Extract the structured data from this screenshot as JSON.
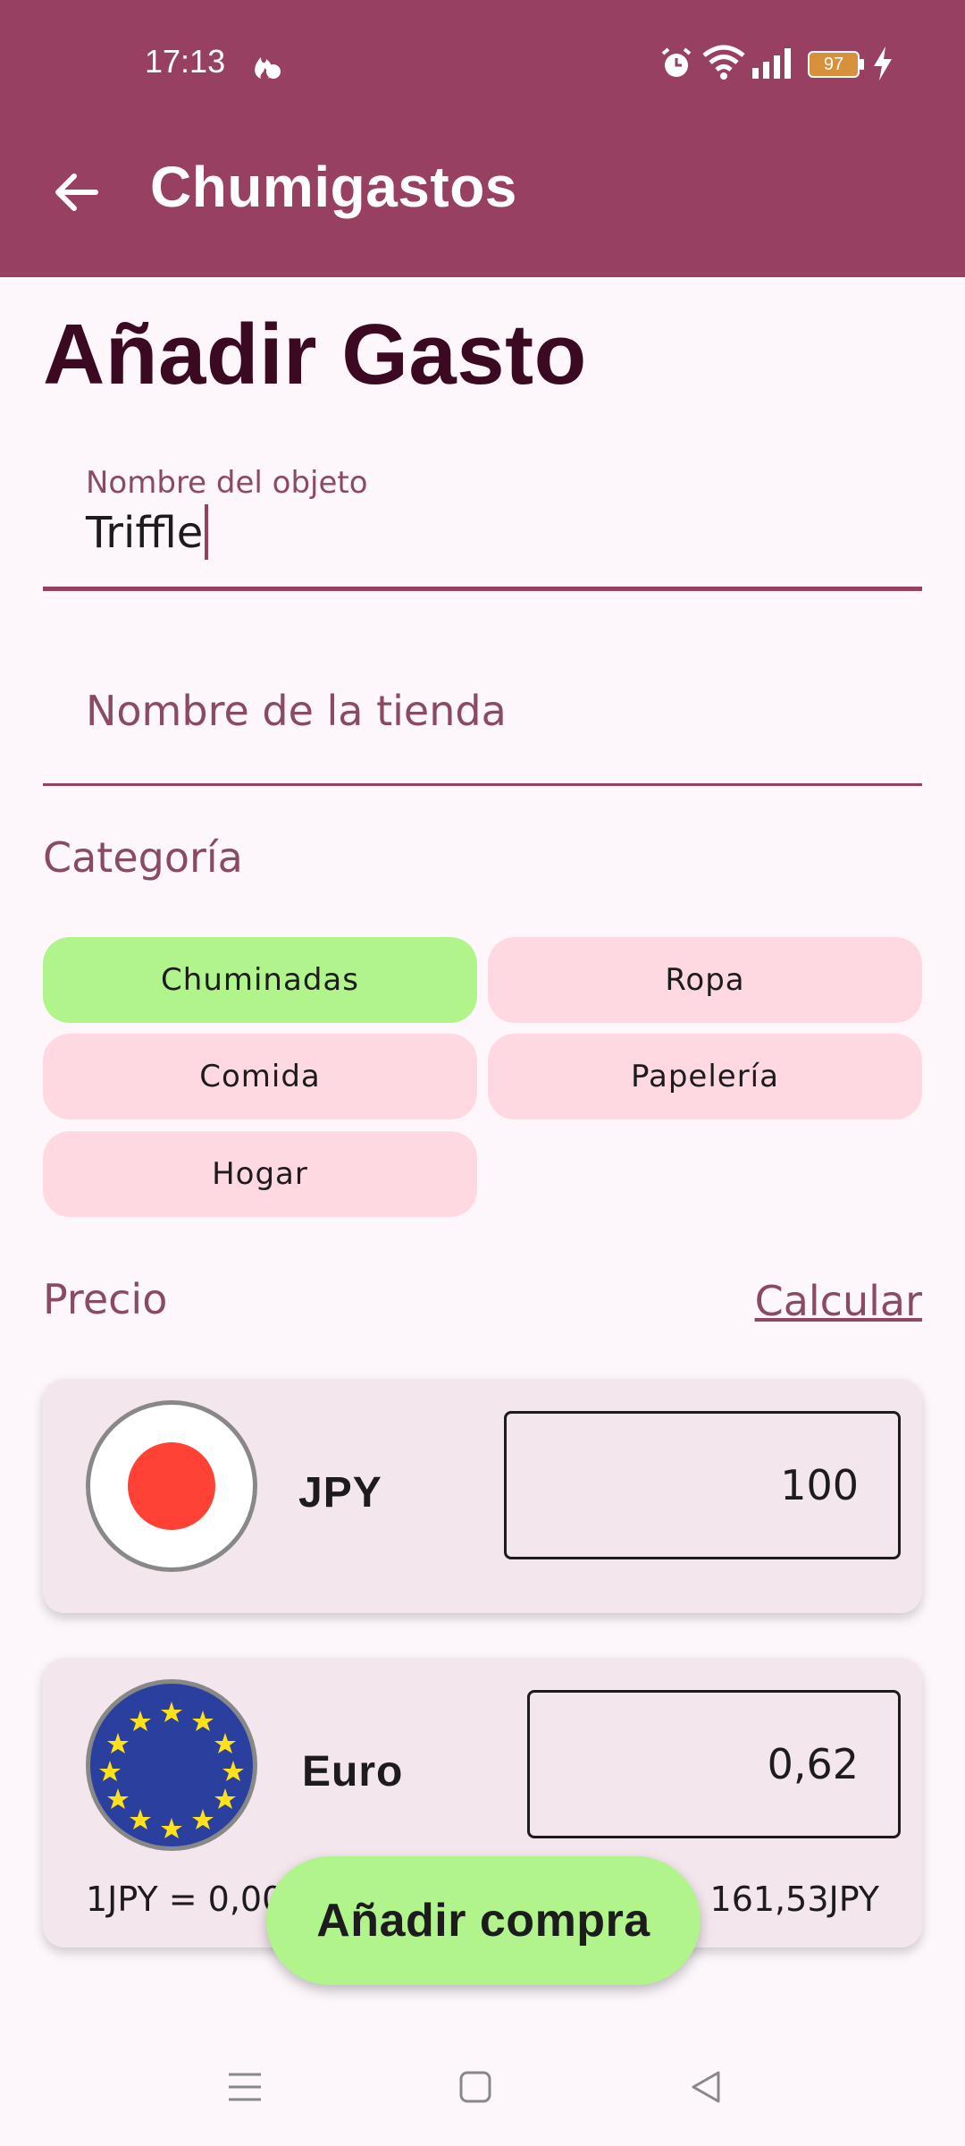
{
  "status_bar": {
    "time": "17:13",
    "battery": "97",
    "icons": [
      "flame-icon",
      "alarm-icon",
      "wifi-icon",
      "signal-icon",
      "battery-icon",
      "charging-icon"
    ]
  },
  "app_bar": {
    "title": "Chumigastos",
    "back_icon": "arrow-left-icon",
    "color": "#984061"
  },
  "page": {
    "title": "Añadir Gasto"
  },
  "form": {
    "item_name": {
      "label": "Nombre del objeto",
      "value": "Triffle"
    },
    "store_name": {
      "placeholder": "Nombre de la tienda",
      "value": ""
    }
  },
  "category": {
    "label": "Categoría",
    "options": [
      {
        "label": "Chuminadas",
        "selected": true
      },
      {
        "label": "Ropa",
        "selected": false
      },
      {
        "label": "Comida",
        "selected": false
      },
      {
        "label": "Papelería",
        "selected": false
      },
      {
        "label": "Hogar",
        "selected": false
      }
    ],
    "selected_color": "#b1f48c",
    "chip_color": "#ffd9e2"
  },
  "price": {
    "label": "Precio",
    "calculate_link": "Calcular",
    "currencies": [
      {
        "code": "JPY",
        "flag_icon": "japan-flag-icon",
        "amount": "100"
      },
      {
        "code": "Euro",
        "flag_icon": "eu-flag-icon",
        "amount": "0,62"
      }
    ],
    "rate_left": "1JPY = 0,00",
    "rate_right": "161,53JPY"
  },
  "fab": {
    "label": "Añadir compra"
  },
  "nav_bar": {
    "icons": [
      "menu-icon",
      "home-square-icon",
      "back-triangle-icon"
    ]
  }
}
